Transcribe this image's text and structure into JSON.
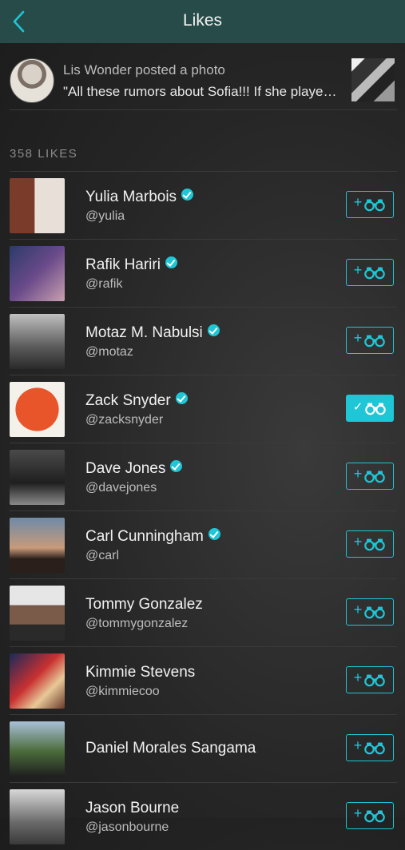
{
  "header": {
    "title": "Likes"
  },
  "post": {
    "line1": "Lis Wonder posted a photo",
    "caption": "\"All these rumors about Sofia!!! If she played it...\""
  },
  "likes_label": "358 LIKES",
  "colors": {
    "accent": "#1fc6d6",
    "header_bg": "#274b49"
  },
  "users": [
    {
      "name": "Yulia Marbois",
      "handle": "@yulia",
      "verified": true,
      "following": false
    },
    {
      "name": "Rafik Hariri",
      "handle": "@rafik",
      "verified": true,
      "following": false
    },
    {
      "name": "Motaz M. Nabulsi",
      "handle": "@motaz",
      "verified": true,
      "following": false
    },
    {
      "name": "Zack Snyder",
      "handle": "@zacksnyder",
      "verified": true,
      "following": true
    },
    {
      "name": "Dave Jones",
      "handle": "@davejones",
      "verified": true,
      "following": false
    },
    {
      "name": "Carl Cunningham",
      "handle": "@carl",
      "verified": true,
      "following": false
    },
    {
      "name": "Tommy Gonzalez",
      "handle": "@tommygonzalez",
      "verified": false,
      "following": false
    },
    {
      "name": "Kimmie Stevens",
      "handle": "@kimmiecoo",
      "verified": false,
      "following": false
    },
    {
      "name": "Daniel Morales Sangama",
      "handle": "",
      "verified": false,
      "following": false
    },
    {
      "name": "Jason Bourne",
      "handle": "@jasonbourne",
      "verified": false,
      "following": false
    }
  ]
}
